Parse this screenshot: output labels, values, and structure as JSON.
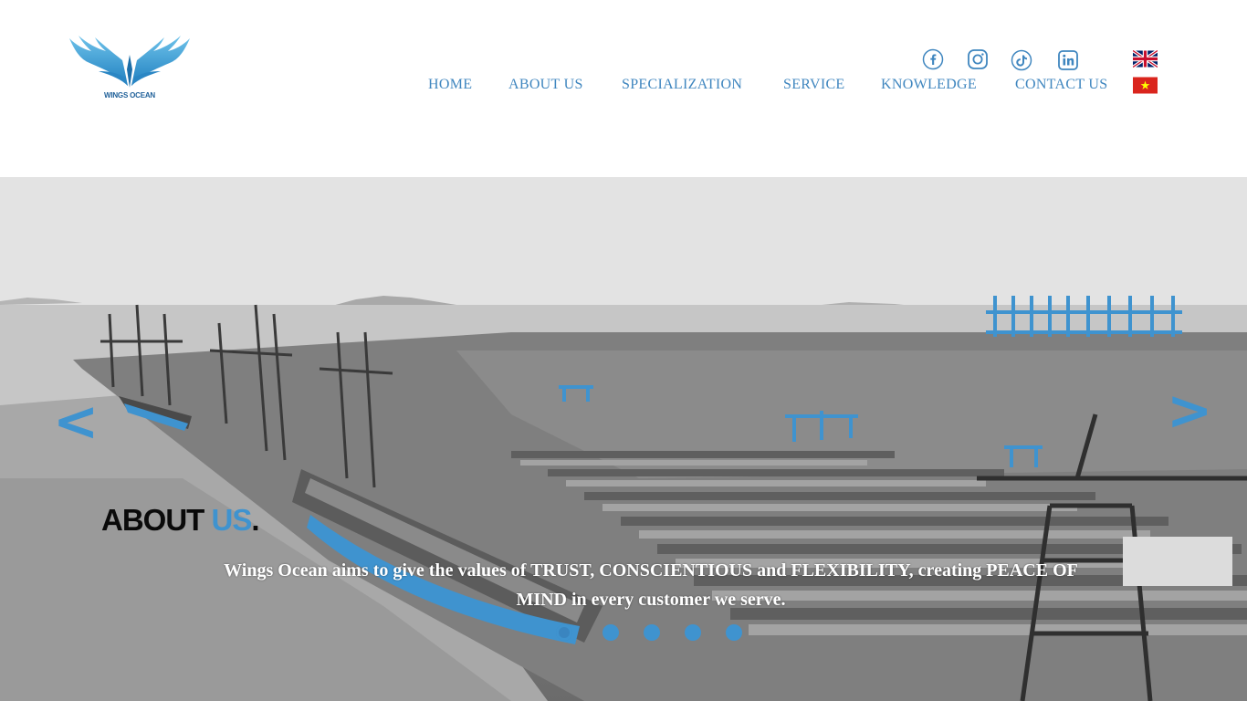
{
  "brand": {
    "name": "WINGS OCEAN",
    "accent": "#3f93cf",
    "nav_color": "#3f86bf"
  },
  "social": [
    {
      "name": "facebook-icon"
    },
    {
      "name": "instagram-icon"
    },
    {
      "name": "tiktok-icon"
    },
    {
      "name": "linkedin-icon"
    }
  ],
  "nav": {
    "items": [
      {
        "label": "HOME"
      },
      {
        "label": "ABOUT US"
      },
      {
        "label": "SPECIALIZATION"
      },
      {
        "label": "SERVICE"
      },
      {
        "label": "KNOWLEDGE"
      },
      {
        "label": "CONTACT US"
      }
    ]
  },
  "languages": [
    {
      "name": "english-flag-icon"
    },
    {
      "name": "vietnam-flag-icon"
    }
  ],
  "hero": {
    "prev_arrow": "<",
    "next_arrow": ">",
    "title_main": "ABOUT ",
    "title_accent": "US",
    "title_dot": ".",
    "description": "Wings Ocean aims to give the values of TRUST, CONSCIENTIOUS and FLEXIBILITY, creating PEACE OF MIND in every customer we serve.",
    "slides_count": 5,
    "active_slide": 1
  }
}
